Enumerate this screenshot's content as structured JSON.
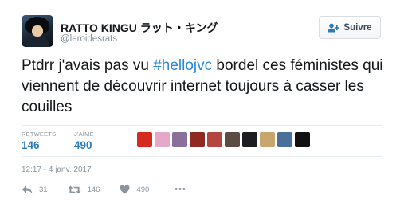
{
  "user": {
    "display_name": "RATTO KINGU ラット・キング",
    "handle": "@leroidesrats"
  },
  "follow": {
    "label": "Suivre"
  },
  "tweet": {
    "text_before": "Ptdrr j'avais pas vu ",
    "hashtag": "#hellojvc",
    "text_after": " bordel ces féministes qui viennent de découvrir internet toujours à casser les couilles"
  },
  "stats": {
    "retweets_label": "RETWEETS",
    "retweets_value": "146",
    "likes_label": "J'AIME",
    "likes_value": "490"
  },
  "likers": [
    {
      "name": "liker-avatar-1",
      "color": "#d42a20"
    },
    {
      "name": "liker-avatar-2",
      "color": "#e6a8c8"
    },
    {
      "name": "liker-avatar-3",
      "color": "#8a6f9c"
    },
    {
      "name": "liker-avatar-4",
      "color": "#8f2a22"
    },
    {
      "name": "liker-avatar-5",
      "color": "#b3473f"
    },
    {
      "name": "liker-avatar-6",
      "color": "#5c4b43"
    },
    {
      "name": "liker-avatar-7",
      "color": "#1e1e22"
    },
    {
      "name": "liker-avatar-8",
      "color": "#c9a66e"
    },
    {
      "name": "liker-avatar-9",
      "color": "#4a6f9a"
    },
    {
      "name": "liker-avatar-10",
      "color": "#111111"
    }
  ],
  "timestamp": "12:17 - 4 janv. 2017",
  "actions": {
    "reply_count": "31",
    "retweet_count": "146",
    "like_count": "490",
    "more_label": "•••"
  },
  "colors": {
    "accent": "#2b7bb9",
    "hashtag": "#2b88d8",
    "muted": "#8a959e"
  }
}
